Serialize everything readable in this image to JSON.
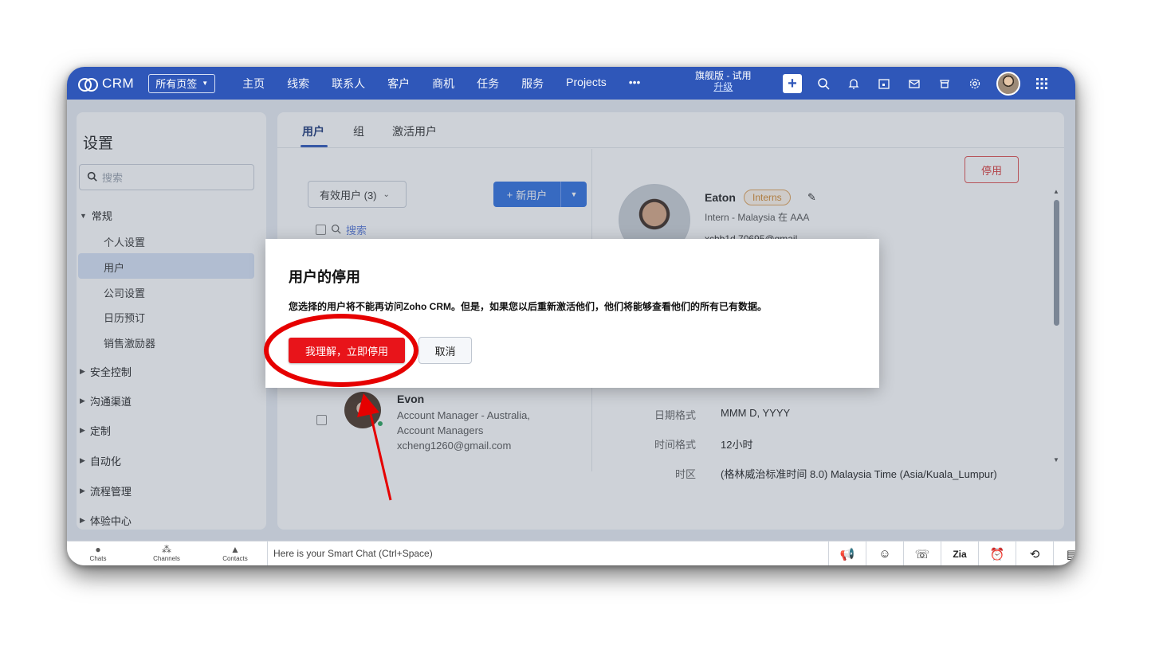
{
  "topbar": {
    "logo": "CRM",
    "tag_selector": "所有页签",
    "nav": [
      "主页",
      "线索",
      "联系人",
      "客户",
      "商机",
      "任务",
      "服务",
      "Projects",
      "•••"
    ],
    "edition": "旗舰版 - 试用",
    "upgrade": "升级",
    "icons": [
      "plus-icon",
      "search-icon",
      "bell-icon",
      "calendar-icon",
      "mail-icon",
      "marketplace-icon",
      "gear-icon",
      "avatar",
      "apps-grid-icon"
    ]
  },
  "sidebar": {
    "title": "设置",
    "search_placeholder": "搜索",
    "general": "常规",
    "general_items": [
      "个人设置",
      "用户",
      "公司设置",
      "日历预订",
      "销售激励器"
    ],
    "sections": [
      "安全控制",
      "沟通渠道",
      "定制",
      "自动化",
      "流程管理",
      "体验中心"
    ]
  },
  "main": {
    "tabs": [
      "用户",
      "组",
      "激活用户"
    ],
    "filter": "有效用户 (3)",
    "new_user": "新用户",
    "list_search": "搜索",
    "deactivate": "停用",
    "profile": {
      "name": "Eaton",
      "badge": "Interns",
      "role": "Intern - Malaysia 在 AAA",
      "email_fragment": "xchb1d.70695@gmail"
    },
    "user": {
      "name": "Evon",
      "role1": "Account Manager - Australia,",
      "role2": "Account Managers",
      "email": "xcheng1260@gmail.com"
    },
    "details": [
      {
        "label": "日期格式",
        "value": "MMM D, YYYY"
      },
      {
        "label": "时间格式",
        "value": "12小时"
      },
      {
        "label": "时区",
        "value": "(格林威治标准时间 8.0) Malaysia Time (Asia/Kuala_Lumpur)"
      }
    ]
  },
  "modal": {
    "title": "用户的停用",
    "message": "您选择的用户将不能再访问Zoho CRM。但是，如果您以后重新激活他们，他们将能够查看他们的所有已有数据。",
    "confirm": "我理解，立即停用",
    "cancel": "取消"
  },
  "bottombar": {
    "chats": "Chats",
    "channels": "Channels",
    "contacts": "Contacts",
    "chat_placeholder": "Here is your Smart Chat (Ctrl+Space)"
  },
  "colors": {
    "topbar": "#2f57b9",
    "confirm_button": "#e8141a",
    "annotation": "#e60000"
  }
}
